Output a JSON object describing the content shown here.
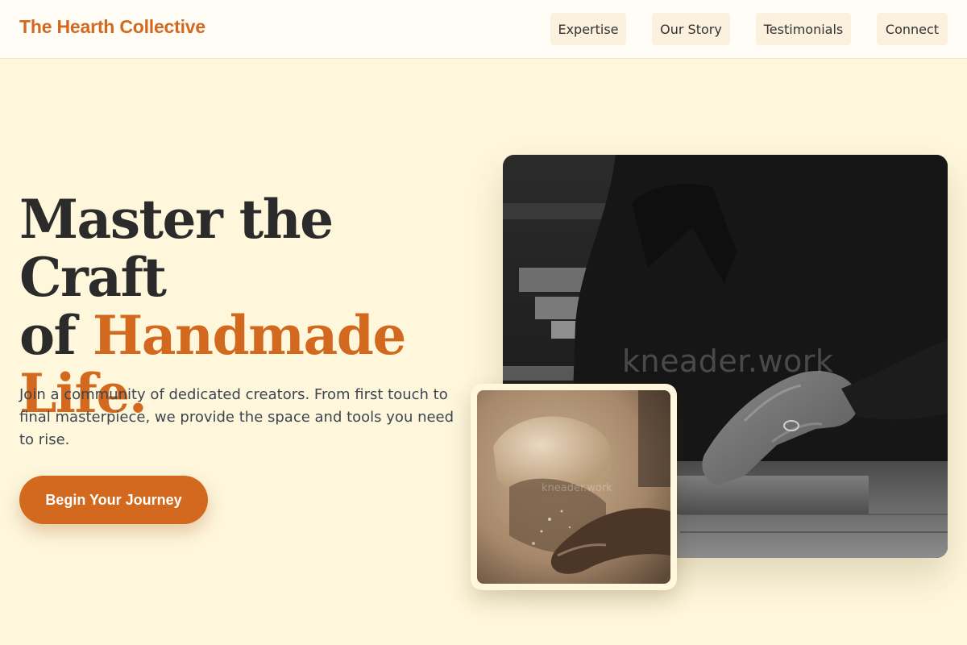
{
  "header": {
    "brand": "The Hearth Collective",
    "nav": [
      "Expertise",
      "Our Story",
      "Testimonials",
      "Connect"
    ]
  },
  "hero": {
    "title_line1": "Master the Craft",
    "title_line2_plain": "of ",
    "title_line2_accent": "Handmade",
    "title_line3_accent": "Life.",
    "description": "Join a community of dedicated creators. From first touch to final masterpiece, we provide the space and tools you need to rise.",
    "cta_label": "Begin Your Journey"
  },
  "images": {
    "main_watermark": "kneader.work",
    "secondary_watermark": "kneader.work"
  },
  "colors": {
    "accent": "#d2691e",
    "background": "#fef7dc",
    "header_bg": "#fffdf6",
    "nav_button_bg": "#fbf1de",
    "text_dark": "#2b2b2b"
  }
}
